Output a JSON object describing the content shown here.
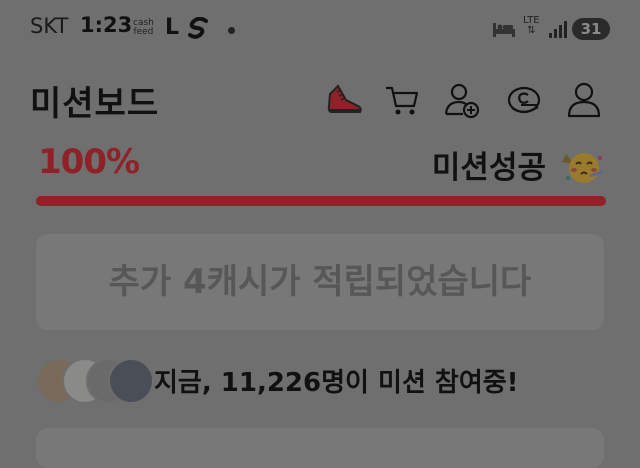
{
  "status_bar": {
    "carrier": "SKT",
    "time": "1:23",
    "cashfeed_top": "cash",
    "cashfeed_bottom": "feed",
    "app_letter": "L",
    "network": "LTE",
    "battery": "31"
  },
  "header": {
    "title": "미션보드",
    "icons": [
      "sneaker-icon",
      "cart-icon",
      "add-friend-icon",
      "coin-icon",
      "profile-icon"
    ]
  },
  "mission": {
    "progress_text": "100%",
    "progress_value": 1.0,
    "status_text": "미션성공",
    "status_emoji": "party-face-emoji",
    "accent_color": "#8e2228"
  },
  "banner": {
    "message": "추가 4캐시가 적립되었습니다"
  },
  "participants": {
    "prefix": "지금, ",
    "count": "11,226명",
    "suffix": "이 미션 참여중!"
  }
}
